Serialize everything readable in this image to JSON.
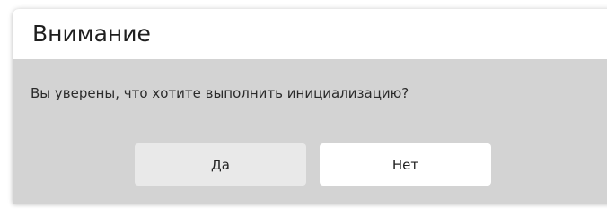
{
  "dialog": {
    "title": "Внимание",
    "message": "Вы уверены, что хотите выполнить инициализацию?",
    "buttons": {
      "yes_label": "Да",
      "no_label": "Нет"
    }
  },
  "colors": {
    "header_bg": "#ffffff",
    "body_bg": "#d3d3d3",
    "yes_button_bg": "#e9e9e9",
    "no_button_bg": "#ffffff"
  }
}
